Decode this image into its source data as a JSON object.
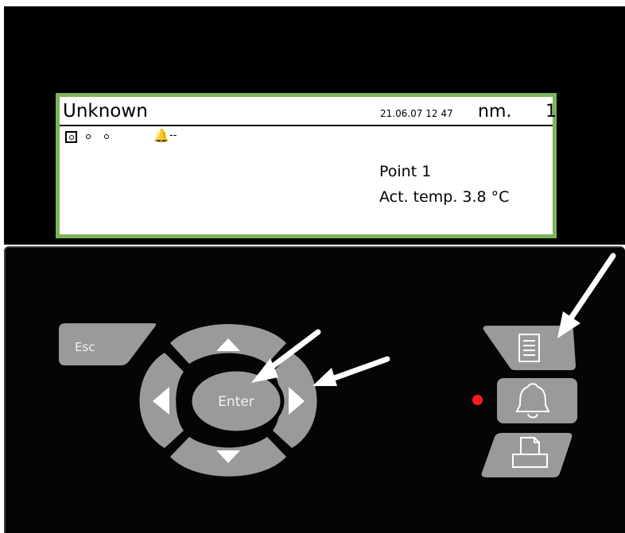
{
  "display": {
    "title": "Unknown",
    "datetime": "21.06.07 12 47",
    "mode": "nm.",
    "number": "1",
    "bell_glyph": "🔔",
    "dash": "--",
    "point_line": "Point  1",
    "temp_line": "Act. temp. 3.8 °C"
  },
  "keypad": {
    "esc_label": "Esc",
    "enter_label": "Enter",
    "up_icon": "arrow-up-icon",
    "down_icon": "arrow-down-icon",
    "left_icon": "arrow-left-icon",
    "right_icon": "arrow-right-icon"
  },
  "side_buttons": {
    "menu_icon": "document-icon",
    "alarm_icon": "bell-icon",
    "print_icon": "printer-icon"
  },
  "colors": {
    "lcd_border": "#7db35d",
    "button_gray": "#9a9a9a",
    "alarm_led": "#ff1a1a",
    "annotation_arrow": "#ffffff"
  }
}
